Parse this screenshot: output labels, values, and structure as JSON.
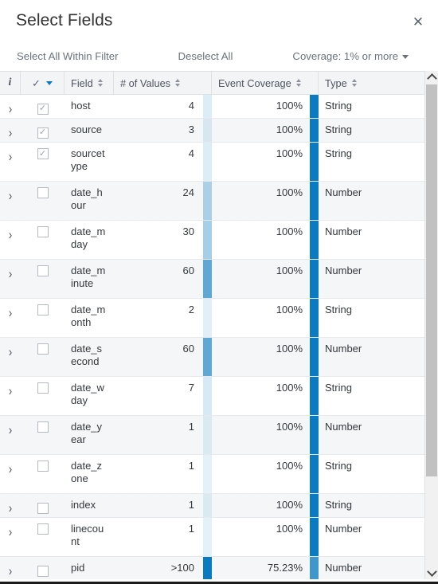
{
  "modal": {
    "title": "Select Fields",
    "close_icon": "close-icon"
  },
  "toolbar": {
    "select_all_within_filter": "Select All Within Filter",
    "deselect_all": "Deselect All",
    "coverage_filter": "Coverage: 1% or more"
  },
  "table": {
    "columns": {
      "info": "i",
      "check": "✓",
      "field": "Field",
      "values": "# of Values",
      "coverage": "Event Coverage",
      "type": "Type"
    },
    "rows": [
      {
        "field": "host",
        "values": "4",
        "values_ratio": 0.04,
        "coverage": "100%",
        "coverage_ratio": 1.0,
        "type": "String",
        "checked": true,
        "two_line": false
      },
      {
        "field": "source",
        "values": "3",
        "values_ratio": 0.03,
        "coverage": "100%",
        "coverage_ratio": 1.0,
        "type": "String",
        "checked": true,
        "two_line": false
      },
      {
        "field": "sourcetype",
        "values": "4",
        "values_ratio": 0.04,
        "coverage": "100%",
        "coverage_ratio": 1.0,
        "type": "String",
        "checked": true,
        "two_line": true
      },
      {
        "field": "date_hour",
        "values": "24",
        "values_ratio": 0.24,
        "coverage": "100%",
        "coverage_ratio": 1.0,
        "type": "Number",
        "checked": false,
        "two_line": true
      },
      {
        "field": "date_mday",
        "values": "30",
        "values_ratio": 0.3,
        "coverage": "100%",
        "coverage_ratio": 1.0,
        "type": "Number",
        "checked": false,
        "two_line": true
      },
      {
        "field": "date_minute",
        "values": "60",
        "values_ratio": 0.6,
        "coverage": "100%",
        "coverage_ratio": 1.0,
        "type": "Number",
        "checked": false,
        "two_line": true
      },
      {
        "field": "date_month",
        "values": "2",
        "values_ratio": 0.02,
        "coverage": "100%",
        "coverage_ratio": 1.0,
        "type": "String",
        "checked": false,
        "two_line": true
      },
      {
        "field": "date_second",
        "values": "60",
        "values_ratio": 0.6,
        "coverage": "100%",
        "coverage_ratio": 1.0,
        "type": "Number",
        "checked": false,
        "two_line": true
      },
      {
        "field": "date_wday",
        "values": "7",
        "values_ratio": 0.07,
        "coverage": "100%",
        "coverage_ratio": 1.0,
        "type": "String",
        "checked": false,
        "two_line": true
      },
      {
        "field": "date_year",
        "values": "1",
        "values_ratio": 0.01,
        "coverage": "100%",
        "coverage_ratio": 1.0,
        "type": "Number",
        "checked": false,
        "two_line": true
      },
      {
        "field": "date_zone",
        "values": "1",
        "values_ratio": 0.01,
        "coverage": "100%",
        "coverage_ratio": 1.0,
        "type": "String",
        "checked": false,
        "two_line": true
      },
      {
        "field": "index",
        "values": "1",
        "values_ratio": 0.01,
        "coverage": "100%",
        "coverage_ratio": 1.0,
        "type": "String",
        "checked": false,
        "two_line": false
      },
      {
        "field": "linecount",
        "values": "1",
        "values_ratio": 0.01,
        "coverage": "100%",
        "coverage_ratio": 1.0,
        "type": "Number",
        "checked": false,
        "two_line": true
      },
      {
        "field": "pid",
        "values": ">100",
        "values_ratio": 1.0,
        "coverage": "75.23%",
        "coverage_ratio": 0.7523,
        "type": "Number",
        "checked": false,
        "two_line": false
      }
    ]
  },
  "scrollbar": {
    "up_icon": "chevron-up-icon",
    "down_icon": "chevron-down-icon"
  },
  "colors": {
    "accent": "#0a7bc2",
    "bar_base": "#0a7bc2",
    "header_bg": "#f3f4f6",
    "border": "#dfe2e5",
    "text": "#33383d",
    "muted": "#6a737c"
  }
}
